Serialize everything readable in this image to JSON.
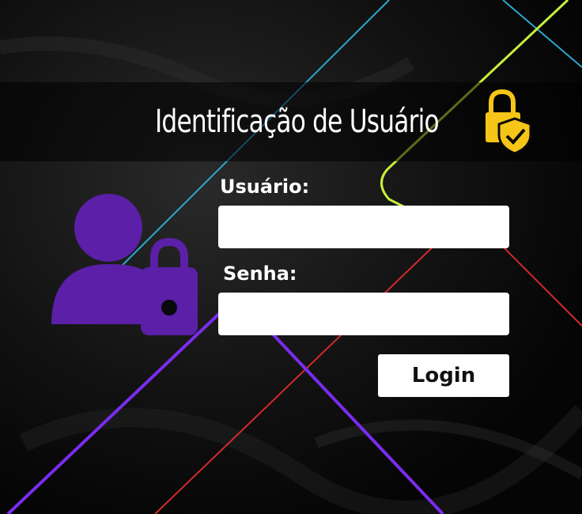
{
  "header": {
    "title": "Identificação de Usuário",
    "icon": "lock-shield-icon"
  },
  "form": {
    "username_label": "Usuário:",
    "username_value": "",
    "username_placeholder": "",
    "password_label": "Senha:",
    "password_value": "",
    "password_placeholder": "",
    "login_label": "Login"
  },
  "icons": {
    "user_lock": "user-lock-icon"
  },
  "colors": {
    "accent_purple": "#5b1fa8",
    "icon_yellow": "#f5c518",
    "line_cyan": "#29a8d0",
    "line_lime": "#c8f03c",
    "line_red": "#d42a2a",
    "line_violet": "#7a2cf0",
    "background": "#0a0a0a"
  }
}
